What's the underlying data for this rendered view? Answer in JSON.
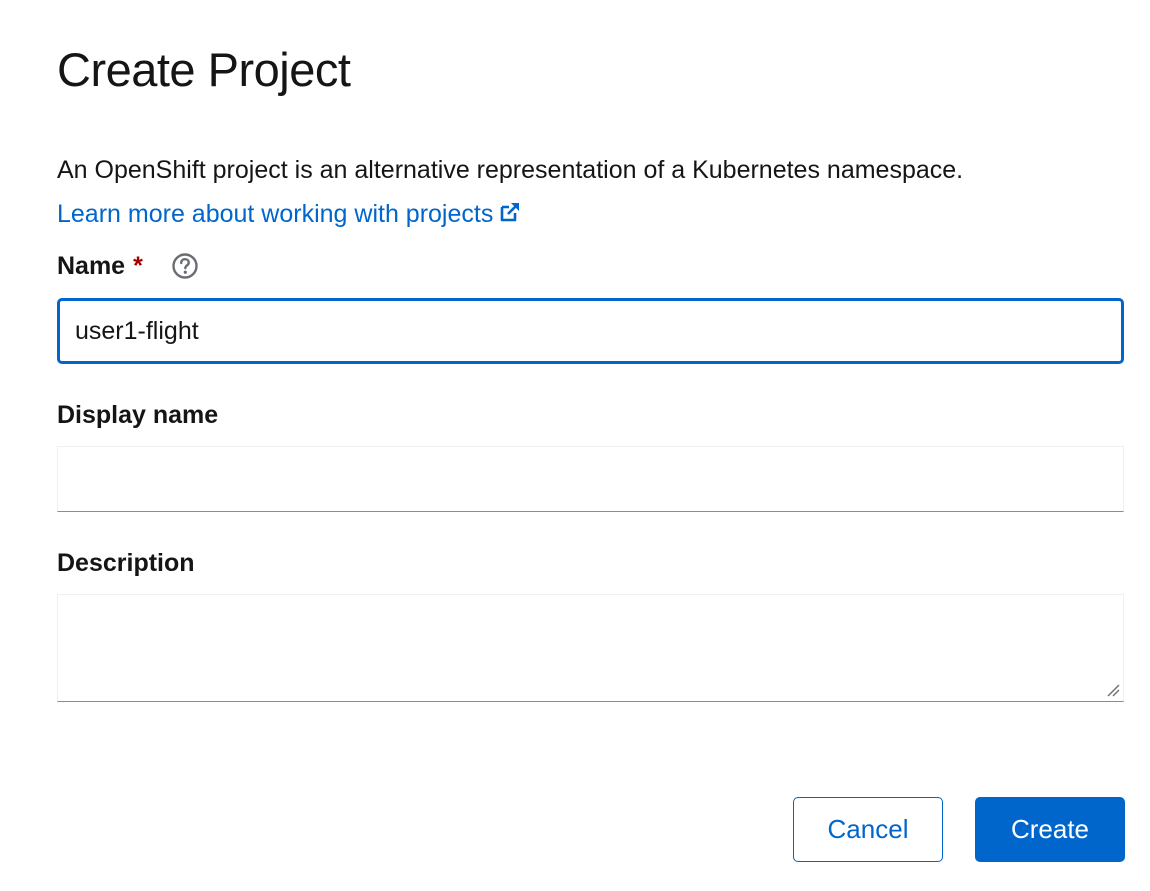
{
  "dialog": {
    "title": "Create Project",
    "intro": "An OpenShift project is an alternative representation of a Kubernetes namespace.",
    "learn_more_link": "Learn more about working with projects"
  },
  "fields": {
    "name": {
      "label": "Name",
      "required_marker": "*",
      "value": "user1-flight"
    },
    "display_name": {
      "label": "Display name",
      "value": ""
    },
    "description": {
      "label": "Description",
      "value": ""
    }
  },
  "actions": {
    "cancel_label": "Cancel",
    "create_label": "Create"
  },
  "colors": {
    "link": "#0066cc",
    "primary": "#0066cc",
    "required": "#a30000",
    "text": "#151515"
  },
  "icons": {
    "external_link": "external-link-icon",
    "help": "help-icon"
  }
}
